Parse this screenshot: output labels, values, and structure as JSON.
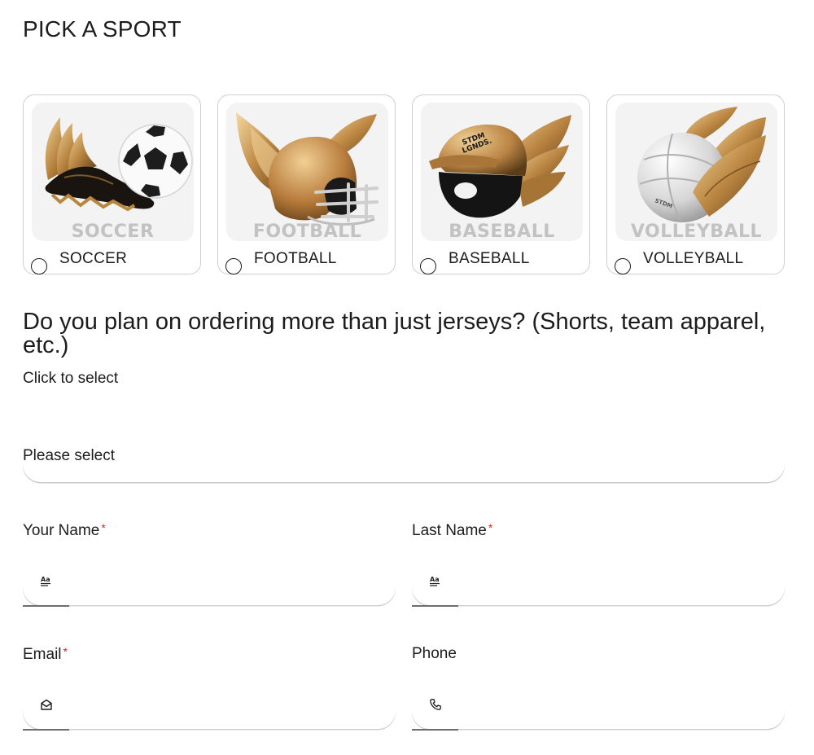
{
  "page_title": "PICK A SPORT",
  "sports": [
    {
      "label": "SOCCER",
      "image_caption": "SOCCER",
      "icon": "winged-soccer-cleat-and-ball-image",
      "selected": false
    },
    {
      "label": "FOOTBALL",
      "image_caption": "FOOTBALL",
      "icon": "winged-football-helmet-image",
      "selected": false
    },
    {
      "label": "BASEBALL",
      "image_caption": "BASEBALL",
      "icon": "winged-baseball-helmet-image",
      "selected": false
    },
    {
      "label": "VOLLEYBALL",
      "image_caption": "VOLLEYBALL",
      "icon": "winged-volleyball-image",
      "selected": false
    }
  ],
  "question": {
    "text": "Do you plan on ordering more than just jerseys? (Shorts, team apparel, etc.)",
    "hint": "Click to select",
    "select_value": "Please select"
  },
  "fields": {
    "first_name": {
      "label": "Your Name",
      "required_mark": "*",
      "icon": "text-format-icon",
      "value": ""
    },
    "last_name": {
      "label": "Last Name",
      "required_mark": "*",
      "icon": "text-format-icon",
      "value": ""
    },
    "email": {
      "label": "Email",
      "required_mark": "*",
      "icon": "mail-open-icon",
      "value": ""
    },
    "phone": {
      "label": "Phone",
      "icon": "phone-icon",
      "value": ""
    }
  },
  "colors": {
    "required": "#e02020",
    "gold": "#c8975a",
    "text": "#1c1c1c",
    "card_border": "#cfcfcf"
  }
}
